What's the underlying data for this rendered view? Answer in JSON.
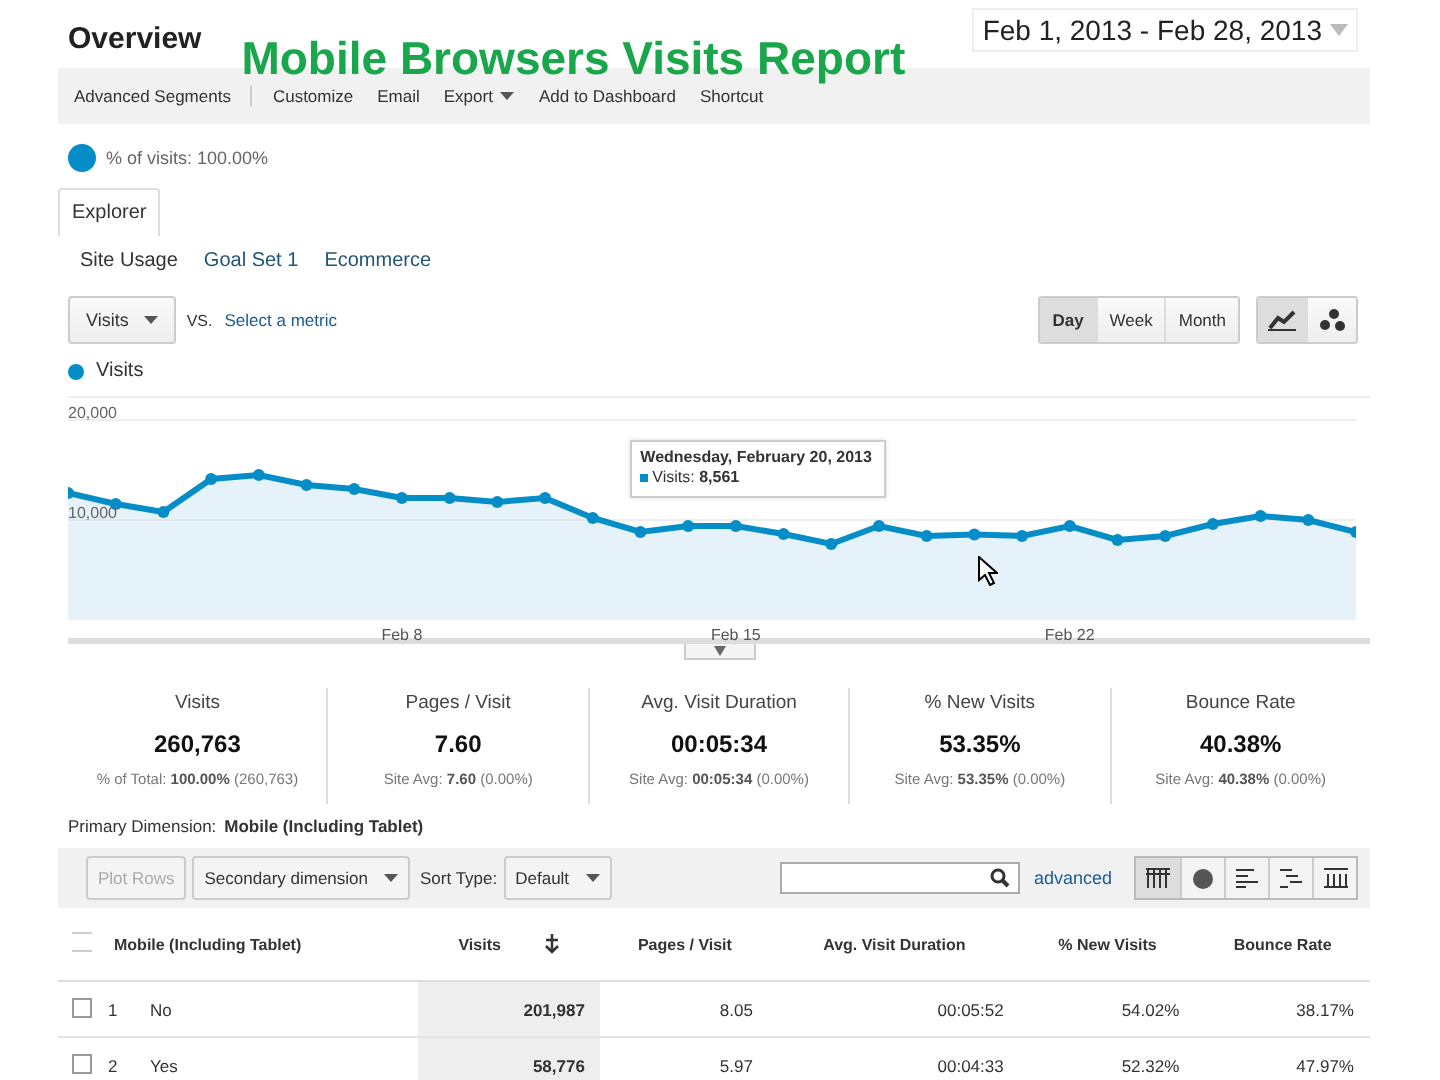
{
  "page_title": "Overview",
  "report_title": "Mobile Browsers Visits Report",
  "date_range": "Feb 1, 2013 - Feb 28, 2013",
  "toolbar": [
    "Advanced Segments",
    "Customize",
    "Email",
    "Export",
    "Add to Dashboard",
    "Shortcut"
  ],
  "segment": "% of visits: 100.00%",
  "tabs": [
    {
      "label": "Explorer",
      "selected": true
    }
  ],
  "subtabs": [
    {
      "label": "Site Usage",
      "selected": true
    },
    {
      "label": "Goal Set 1",
      "selected": false
    },
    {
      "label": "Ecommerce",
      "selected": false
    }
  ],
  "metric_select": "Visits",
  "vs": "VS.",
  "select_metric": "Select a metric",
  "periods": [
    {
      "label": "Day",
      "selected": true
    },
    {
      "label": "Week",
      "selected": false
    },
    {
      "label": "Month",
      "selected": false
    }
  ],
  "chart": {
    "chart_data": {
      "type": "area",
      "categories": [
        null,
        null,
        null,
        null,
        null,
        null,
        null,
        "Feb 8",
        null,
        null,
        null,
        null,
        null,
        null,
        "Feb 15",
        null,
        null,
        null,
        null,
        null,
        null,
        "Feb 22",
        null,
        null,
        null,
        null,
        null,
        null
      ],
      "series": [
        {
          "name": "Visits",
          "color": "#058dc7",
          "values": [
            12700,
            11600,
            10800,
            14100,
            14500,
            13500,
            13100,
            12200,
            12200,
            11800,
            12200,
            10200,
            8800,
            9400,
            9400,
            8600,
            7600,
            9400,
            8400,
            8561,
            8400,
            9400,
            8000,
            8400,
            9600,
            10400,
            10000,
            8800
          ]
        }
      ],
      "ylim": [
        0,
        20000
      ],
      "yticks": [
        {
          "value": 10000,
          "label": "10,000"
        },
        {
          "value": 20000,
          "label": "20,000"
        }
      ]
    },
    "tooltip": {
      "title": "Wednesday, February 20, 2013",
      "label": "Visits:",
      "value": "8,561"
    }
  },
  "metrics": [
    {
      "name": "Visits",
      "value": "260,763",
      "sub_label": "% of Total:",
      "sub_value": "100.00%",
      "sub_extra": "(260,763)"
    },
    {
      "name": "Pages / Visit",
      "value": "7.60",
      "sub_label": "Site Avg:",
      "sub_value": "7.60",
      "sub_extra": "(0.00%)"
    },
    {
      "name": "Avg. Visit Duration",
      "value": "00:05:34",
      "sub_label": "Site Avg:",
      "sub_value": "00:05:34",
      "sub_extra": "(0.00%)"
    },
    {
      "name": "% New Visits",
      "value": "53.35%",
      "sub_label": "Site Avg:",
      "sub_value": "53.35%",
      "sub_extra": "(0.00%)"
    },
    {
      "name": "Bounce Rate",
      "value": "40.38%",
      "sub_label": "Site Avg:",
      "sub_value": "40.38%",
      "sub_extra": "(0.00%)"
    }
  ],
  "primary_dimension": {
    "label": "Primary Dimension:",
    "value": "Mobile (Including Tablet)"
  },
  "table_toolbar": {
    "plot_rows": "Plot Rows",
    "secondary": "Secondary dimension",
    "sort_label": "Sort Type:",
    "sort": "Default",
    "advanced": "advanced"
  },
  "table": {
    "all_checked": false,
    "columns": [
      "Mobile (Including Tablet)",
      "Visits",
      "Pages / Visit",
      "Avg. Visit Duration",
      "% New Visits",
      "Bounce Rate"
    ],
    "rows": [
      {
        "checked": false,
        "index": "1",
        "cells": [
          "No",
          "201,987",
          "8.05",
          "00:05:52",
          "54.02%",
          "38.17%"
        ]
      },
      {
        "checked": false,
        "index": "2",
        "cells": [
          "Yes",
          "58,776",
          "5.97",
          "00:04:33",
          "52.32%",
          "47.97%"
        ]
      }
    ]
  }
}
